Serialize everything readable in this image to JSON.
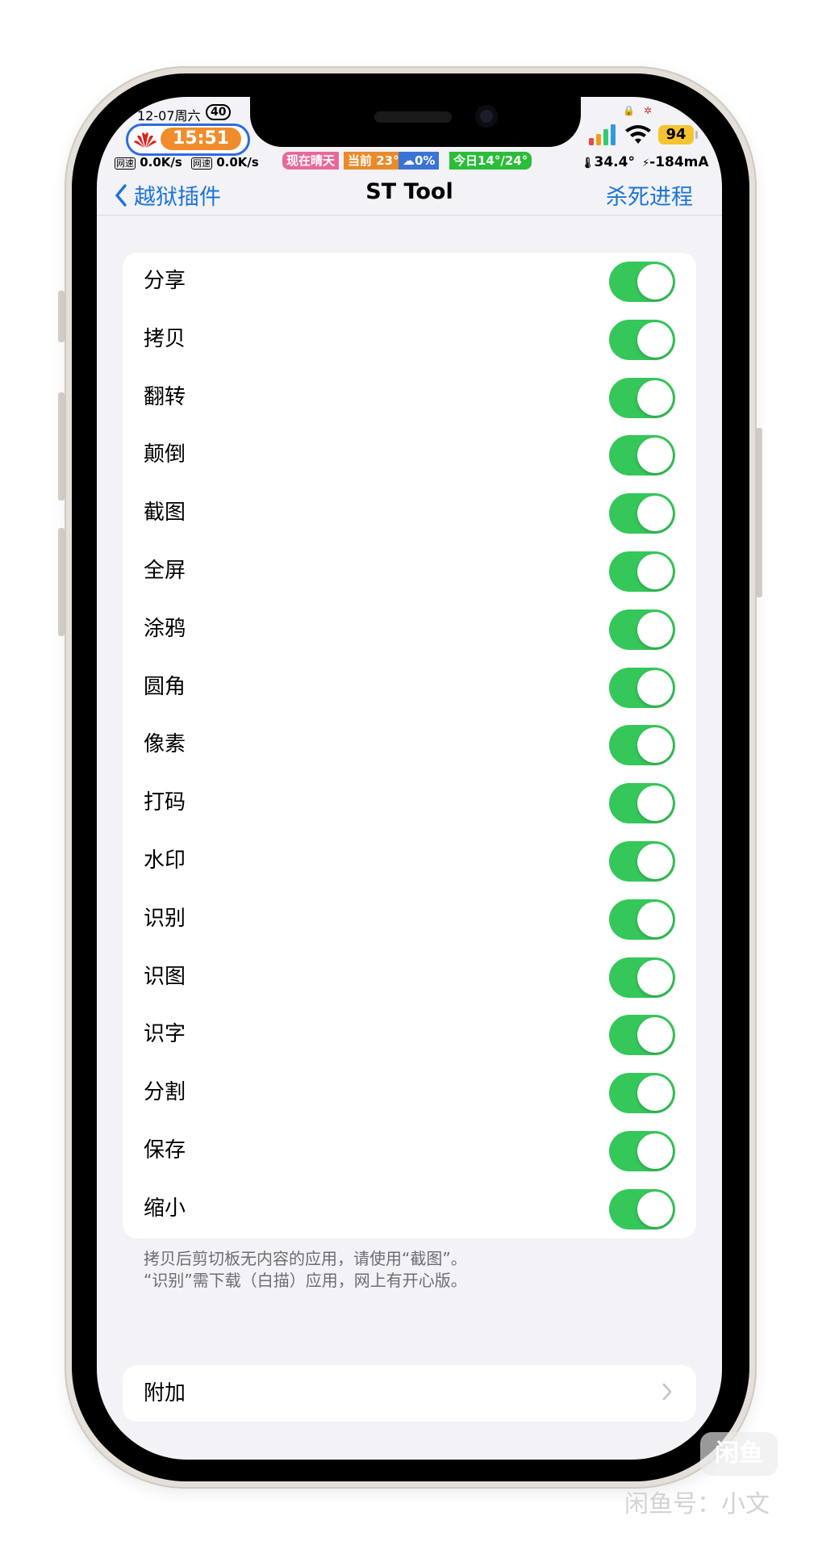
{
  "status_bar": {
    "date": "12-07周六",
    "date_badge": "40",
    "time": "15:51",
    "net_down_label": "网速",
    "net_down": "0.0K/s",
    "net_up_label": "网速",
    "net_up": "0.0K/s",
    "weather_now": "现在晴天",
    "weather_current": "当前 23°",
    "weather_rain": "0%",
    "weather_today": "今日14°/24°",
    "battery": "94",
    "temperature": "34.4°",
    "current": "-184mA",
    "colors": {
      "weather_now": "#e56a9a",
      "weather_current": "#e98a2a",
      "weather_rain": "#3a73d6",
      "weather_today": "#2bbd3a",
      "battery": "#f6c330",
      "time_pill": "#f08c2c"
    }
  },
  "nav": {
    "back_label": "越狱插件",
    "title": "ST Tool",
    "action_label": "杀死进程"
  },
  "toggles": [
    {
      "label": "分享",
      "on": true
    },
    {
      "label": "拷贝",
      "on": true
    },
    {
      "label": "翻转",
      "on": true
    },
    {
      "label": "颠倒",
      "on": true
    },
    {
      "label": "截图",
      "on": true
    },
    {
      "label": "全屏",
      "on": true
    },
    {
      "label": "涂鸦",
      "on": true
    },
    {
      "label": "圆角",
      "on": true
    },
    {
      "label": "像素",
      "on": true
    },
    {
      "label": "打码",
      "on": true
    },
    {
      "label": "水印",
      "on": true
    },
    {
      "label": "识别",
      "on": true
    },
    {
      "label": "识图",
      "on": true
    },
    {
      "label": "识字",
      "on": true
    },
    {
      "label": "分割",
      "on": true
    },
    {
      "label": "保存",
      "on": true
    },
    {
      "label": "缩小",
      "on": true
    }
  ],
  "footer": {
    "line1": "拷贝后剪切板无内容的应用，请使用“截图”。",
    "line2": "“识别”需下载（白描）应用，网上有开心版。"
  },
  "extra": {
    "label": "附加"
  },
  "watermark": {
    "logo_text": "闲鱼",
    "text": "闲鱼号：小文"
  },
  "colors": {
    "accent": "#1d74d9",
    "toggle_on": "#35c759",
    "background": "#f2f2f7"
  }
}
